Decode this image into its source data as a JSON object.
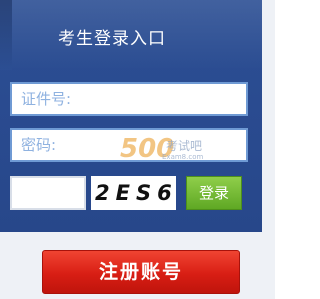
{
  "login": {
    "title": "考生登录入口",
    "id_placeholder": "证件号:",
    "password_placeholder": "密码:",
    "captcha_code": "2ES6",
    "login_label": "登录"
  },
  "watermark": {
    "number": "500",
    "text": "考试吧",
    "sub": "Exam8.com"
  },
  "register": {
    "label": "注册账号"
  },
  "colors": {
    "panel": "#2c4f94",
    "field_border": "#6f9ad4",
    "login_button": "#6cb52f",
    "register_button": "#d81e14"
  }
}
